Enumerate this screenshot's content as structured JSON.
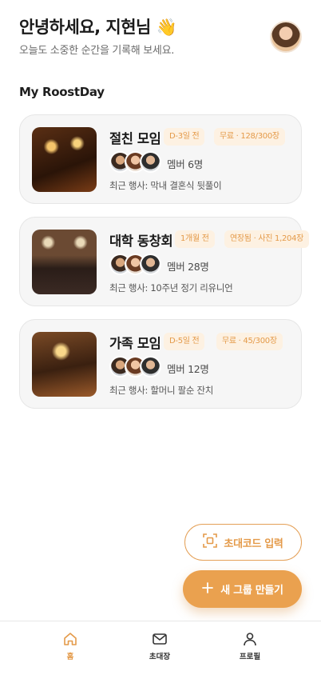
{
  "header": {
    "greeting": "안녕하세요, 지현님 👋",
    "subtitle": "오늘도 소중한 순간을 기록해 보세요."
  },
  "section_title": "My RoostDay",
  "groups": [
    {
      "title": "절친 모임",
      "badge_date": "D-3일 전",
      "badge_plan": "무료 · 128/300장",
      "members": "멤버 6명",
      "recent": "최근 행사: 막내 결혼식 뒷풀이"
    },
    {
      "title": "대학 동창회",
      "badge_date": "1개월 전",
      "badge_plan": "연장됨 · 사진 1,204장",
      "members": "멤버 28명",
      "recent": "최근 행사: 10주년 정기 리유니언"
    },
    {
      "title": "가족 모임",
      "badge_date": "D-5일 전",
      "badge_plan": "무료 · 45/300장",
      "members": "멤버 12명",
      "recent": "최근 행사: 할머니 팔순 잔치"
    }
  ],
  "actions": {
    "invite_label": "초대코드 입력",
    "create_label": "새 그룹 만들기"
  },
  "tabbar": {
    "home": "홈",
    "invite": "초대장",
    "profile": "프로필"
  },
  "colors": {
    "accent": "#eaa14f",
    "accent_text": "#e49a49",
    "badge_bg": "#fdf1e2",
    "card_bg": "#f6f6f6"
  },
  "icons": [
    "qr-scan-icon",
    "plus-icon",
    "home-icon",
    "mail-icon",
    "user-icon"
  ]
}
